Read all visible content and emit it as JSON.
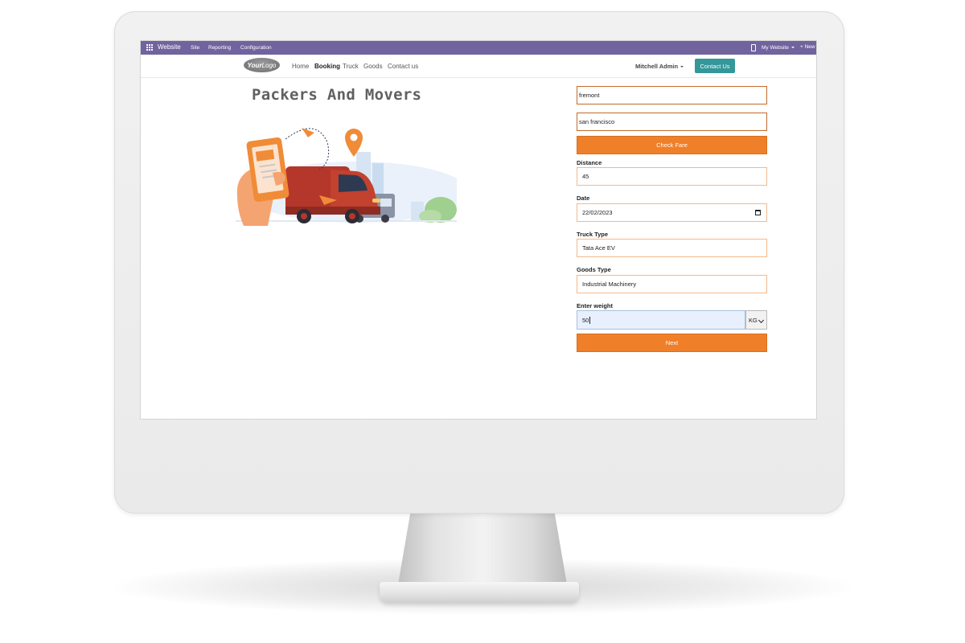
{
  "odoo_bar": {
    "app_name": "Website",
    "menus": [
      "Site",
      "Reporting",
      "Configuration"
    ],
    "my_website": "My Website",
    "new_label": "New"
  },
  "site_nav": {
    "logo_text_bold": "Your",
    "logo_text_rest": "Logo",
    "links": [
      "Home",
      "Booking",
      "Truck",
      "Goods",
      "Contact us"
    ],
    "active_link": "Booking",
    "user": "Mitchell Admin",
    "contact_button": "Contact Us"
  },
  "page": {
    "title": "Packers And Movers"
  },
  "form": {
    "from_value": "fremont",
    "to_value": "san francisco",
    "check_fare_label": "Check Fare",
    "distance_label": "Distance",
    "distance_value": "45",
    "date_label": "Date",
    "date_value": "22/02/2023",
    "truck_type_label": "Truck Type",
    "truck_type_value": "Tata Ace EV",
    "goods_type_label": "Goods Type",
    "goods_type_value": "Industrial Machinery",
    "weight_label": "Enter weight",
    "weight_value": "50",
    "weight_unit": "KG",
    "next_label": "Next"
  },
  "colors": {
    "odoo_purple": "#71639e",
    "accent_orange": "#ef7f29",
    "contact_teal": "#34979a",
    "field_border": "#f3b98c"
  }
}
